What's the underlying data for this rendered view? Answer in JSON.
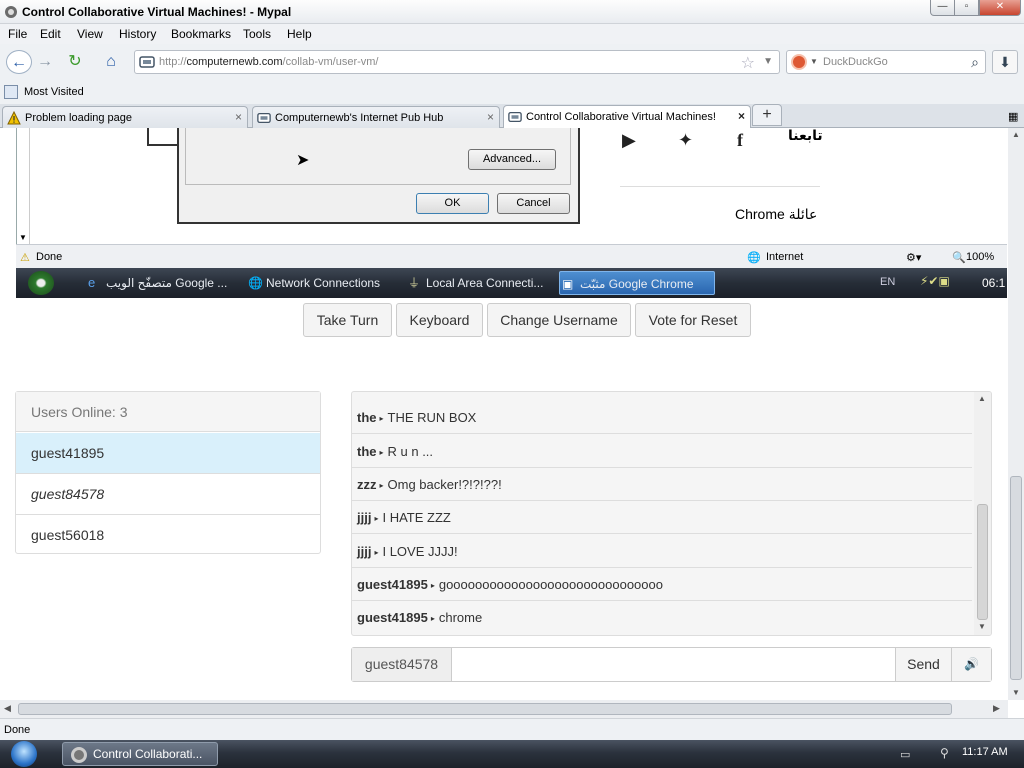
{
  "window": {
    "title": "Control Collaborative Virtual Machines! - Mypal"
  },
  "menu": [
    "File",
    "Edit",
    "View",
    "History",
    "Bookmarks",
    "Tools",
    "Help"
  ],
  "nav": {
    "url_prefix": "http://",
    "url_domain": "computernewb.com",
    "url_path": "/collab-vm/user-vm/",
    "search_placeholder": "DuckDuckGo"
  },
  "bookmarks": {
    "item": "Most Visited"
  },
  "tabs": [
    {
      "label": "Problem loading page"
    },
    {
      "label": "Computernewb's Internet Pub Hub"
    },
    {
      "label": "Control Collaborative Virtual Machines!"
    }
  ],
  "vm": {
    "dialog": {
      "advanced": "Advanced...",
      "ok": "OK",
      "cancel": "Cancel"
    },
    "page": {
      "follow_us": "تابعنا",
      "chrome_family": "Chrome عائلة"
    },
    "status": {
      "done": "Done",
      "zone": "Internet",
      "zoom": "100%"
    },
    "taskbar": {
      "items": [
        "متصفّح الويب Google ...",
        "Network Connections",
        "Local Area Connecti...",
        "مثبّت Google Chrome"
      ],
      "lang": "EN",
      "clock": "06:1"
    }
  },
  "controls": {
    "take_turn": "Take Turn",
    "keyboard": "Keyboard",
    "change_username": "Change Username",
    "vote_reset": "Vote for Reset"
  },
  "users": {
    "header": "Users Online: 3",
    "list": [
      "guest41895",
      "guest84578",
      "guest56018"
    ]
  },
  "chat": {
    "messages": [
      {
        "user": "the",
        "text": "THE RUN BOX"
      },
      {
        "user": "the",
        "text": "R u n ..."
      },
      {
        "user": "zzz",
        "text": "Omg backer!?!?!??!"
      },
      {
        "user": "jjjj",
        "text": "I HATE ZZZ"
      },
      {
        "user": "jjjj",
        "text": "I LOVE JJJJ!"
      },
      {
        "user": "guest41895",
        "text": "goooooooooooooooooooooooooooooo"
      },
      {
        "user": "guest41895",
        "text": "chrome"
      }
    ],
    "username": "guest84578",
    "input_value": "",
    "send": "Send"
  },
  "status": {
    "text": "Done"
  },
  "os_taskbar": {
    "task": "Control Collaborati...",
    "clock": "11:17 AM"
  },
  "colors": {
    "selected_user": "#d9f0fb",
    "accent": "#2b5ea8"
  }
}
